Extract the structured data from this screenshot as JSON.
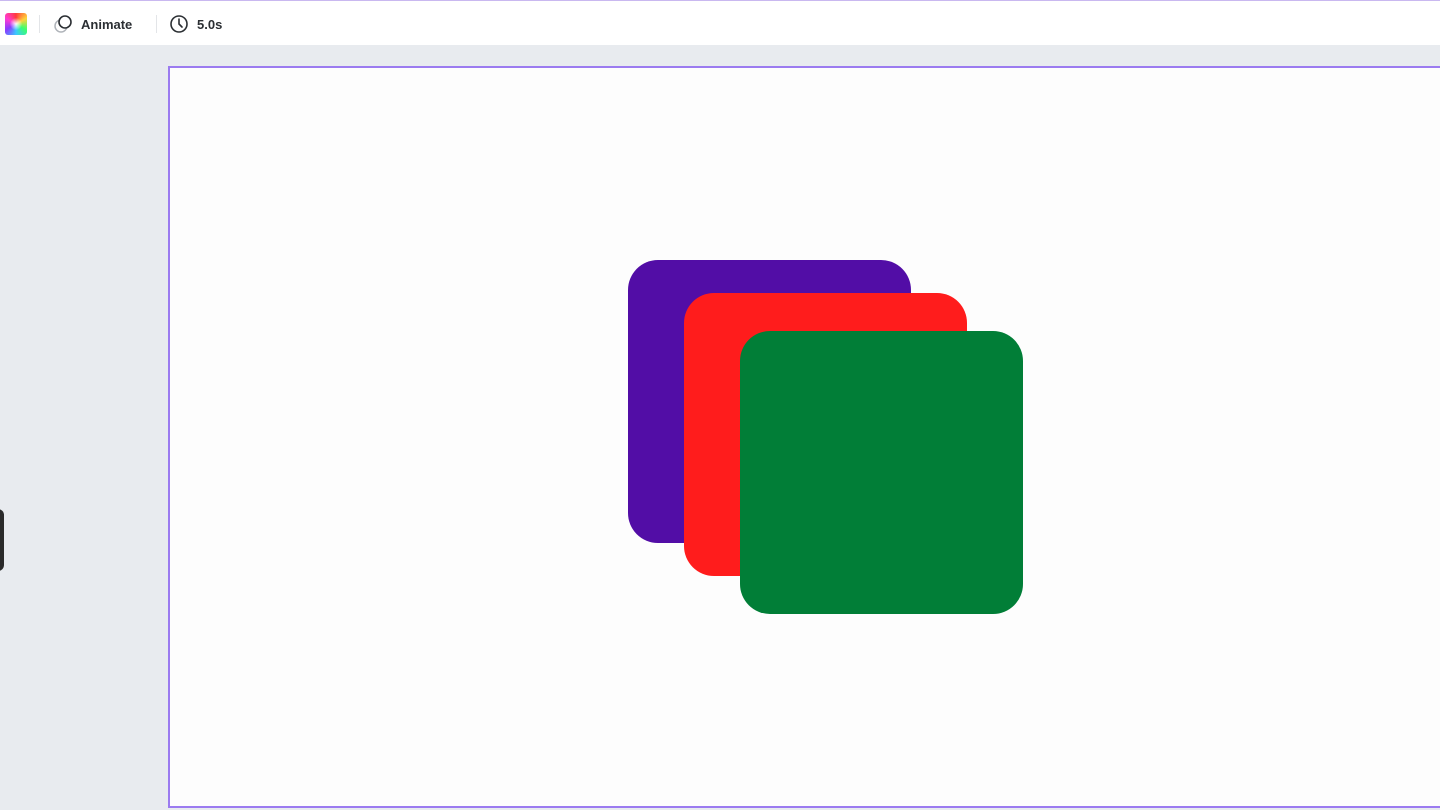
{
  "toolbar": {
    "color_icon": "color-palette-icon",
    "animate": {
      "icon": "animate-icon",
      "label": "Animate"
    },
    "duration": {
      "icon": "clock-icon",
      "label": "5.0s"
    }
  },
  "canvas": {
    "shapes": [
      {
        "name": "purple-square",
        "color": "#520da6"
      },
      {
        "name": "red-square",
        "color": "#ff1c1c"
      },
      {
        "name": "green-square",
        "color": "#017e37"
      }
    ]
  }
}
